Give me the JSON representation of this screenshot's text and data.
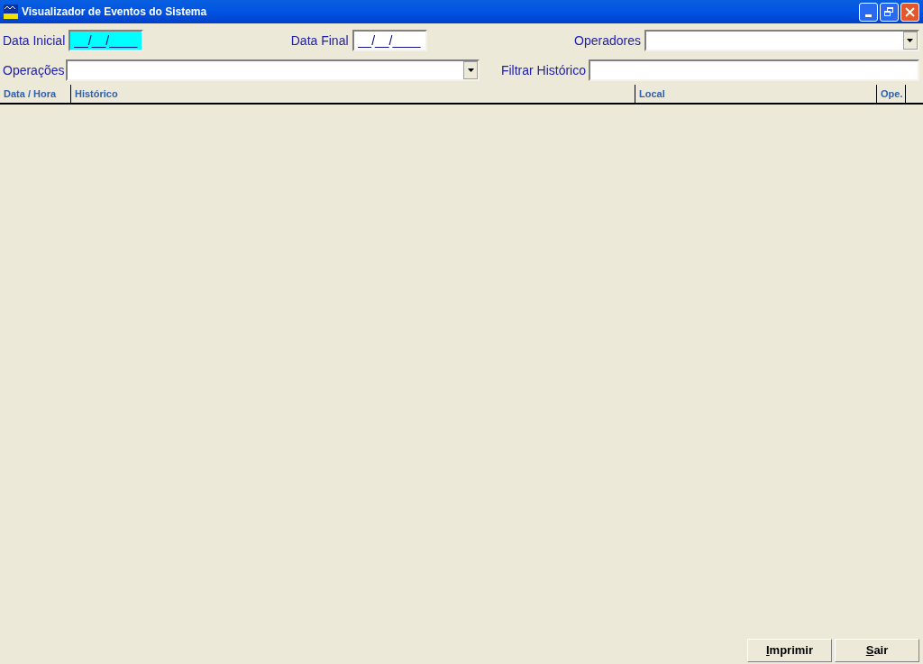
{
  "window": {
    "title": "Visualizador de Eventos do Sistema"
  },
  "filters": {
    "data_inicial": {
      "label": "Data Inicial",
      "value": "__/__/____",
      "focused": true
    },
    "data_final": {
      "label": "Data Final",
      "value": "__/__/____",
      "focused": false
    },
    "operadores": {
      "label": "Operadores"
    },
    "operacoes": {
      "label": "Operações"
    },
    "filtrar_historico": {
      "label": "Filtrar Histórico"
    }
  },
  "table": {
    "columns": [
      "Data / Hora",
      "Histórico",
      "Local",
      "Ope."
    ]
  },
  "buttons": [
    "Imprimir",
    "Sair"
  ]
}
